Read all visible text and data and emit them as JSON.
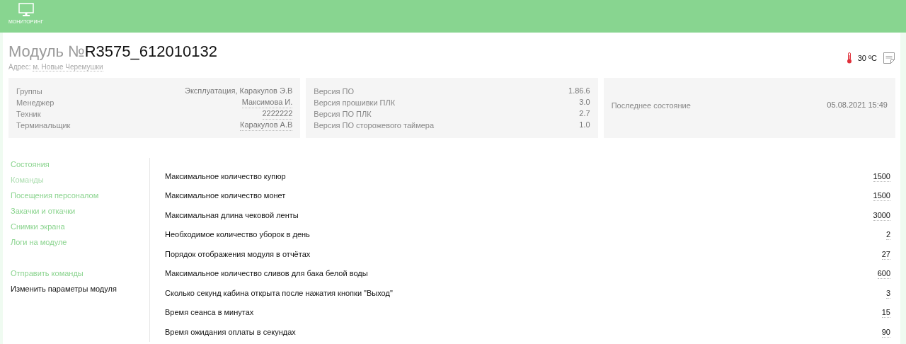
{
  "top_nav": {
    "items": [
      {
        "label": "МОНИТОРИНГ",
        "selected": true
      }
    ]
  },
  "header": {
    "title_prefix": "Модуль №",
    "module_number": "R3575_612010132",
    "address_label": "Адрес:",
    "address": "м. Новые Черемушки",
    "temperature": "30 ºC"
  },
  "info_cards": [
    {
      "rows": [
        {
          "label": "Группы",
          "value": "Эксплуатация, Каракулов Э.В",
          "editable": false
        },
        {
          "label": "Менеджер",
          "value": "Максимова И.",
          "editable": true
        },
        {
          "label": "Техник",
          "value": "2222222",
          "editable": true
        },
        {
          "label": "Терминальщик",
          "value": "Каракулов А.В",
          "editable": true
        }
      ]
    },
    {
      "rows": [
        {
          "label": "Версия ПО",
          "value": "1.86.6",
          "editable": false
        },
        {
          "label": "Версия прошивки ПЛК",
          "value": "3.0",
          "editable": false
        },
        {
          "label": "Версия ПО ПЛК",
          "value": "2.7",
          "editable": false
        },
        {
          "label": "Версия ПО сторожевого таймера",
          "value": "1.0",
          "editable": false
        }
      ]
    },
    {
      "rows": [
        {
          "label": "Последнее состояние",
          "value": "05.08.2021 15:49",
          "editable": false
        }
      ]
    }
  ],
  "sidebar": {
    "groups": [
      {
        "items": [
          {
            "label": "Состояния",
            "selected": false,
            "disabled": false
          },
          {
            "label": "Команды",
            "selected": false,
            "disabled": true
          },
          {
            "label": "Посещения персоналом",
            "selected": false,
            "disabled": false
          },
          {
            "label": "Закачки и откачки",
            "selected": false,
            "disabled": false
          },
          {
            "label": "Снимки экрана",
            "selected": false,
            "disabled": false
          },
          {
            "label": "Логи на модуле",
            "selected": false,
            "disabled": false
          }
        ]
      },
      {
        "items": [
          {
            "label": "Отправить команды",
            "selected": false,
            "disabled": false
          },
          {
            "label": "Изменить параметры модуля",
            "selected": true,
            "disabled": false
          }
        ]
      }
    ]
  },
  "parameters": [
    {
      "label": "Максимальное количество купюр",
      "value": "1500"
    },
    {
      "label": "Максимальное количество монет",
      "value": "1500"
    },
    {
      "label": "Максимальная длина чековой ленты",
      "value": "3000"
    },
    {
      "label": "Необходимое количество уборок в день",
      "value": "2"
    },
    {
      "label": "Порядок отображения модуля в отчётах",
      "value": "27"
    },
    {
      "label": "Максимальное количество сливов для бака белой воды",
      "value": "600"
    },
    {
      "label": "Сколько секунд кабина открыта после нажатия кнопки \"Выход\"",
      "value": "3"
    },
    {
      "label": "Время сеанса в минутах",
      "value": "15"
    },
    {
      "label": "Время ожидания оплаты в секундах",
      "value": "90"
    }
  ]
}
